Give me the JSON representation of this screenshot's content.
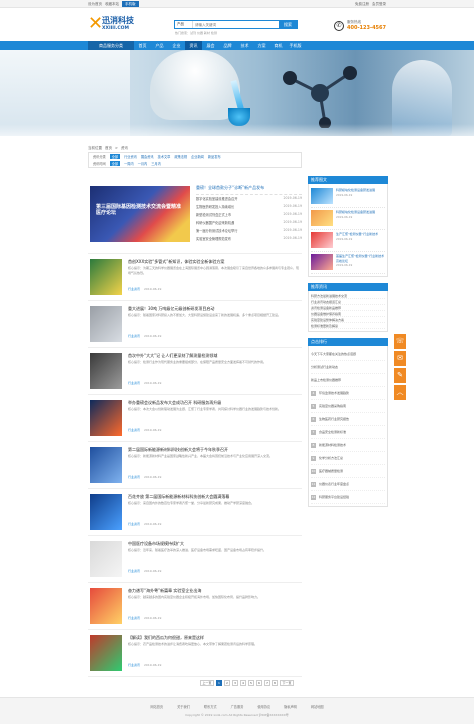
{
  "topbar": {
    "links": [
      "设为首页",
      "收藏本站"
    ],
    "app_button": "手机版",
    "right": [
      "免费注册",
      "会员登录"
    ]
  },
  "header": {
    "logo_cn": "迅消科技",
    "logo_en": "XXIIII.COM",
    "search_select": "产品",
    "search_placeholder": "请输入关键词",
    "search_button": "搜索",
    "hot_words": "热门搜索：试剂 仪器 耗材 检测",
    "phone_label": "服务热线",
    "phone_number": "400-123-4567"
  },
  "nav": {
    "category": "商品服务分类",
    "items": [
      "首页",
      "产品",
      "企业",
      "资讯",
      "展会",
      "品牌",
      "技术",
      "方案",
      "商机",
      "手机版"
    ],
    "active_index": 3
  },
  "breadcrumb": [
    "当前位置",
    "首页",
    "资讯"
  ],
  "filter": {
    "rows": [
      {
        "label": "资讯分类",
        "options": [
          "全部",
          "行业资讯",
          "展会资讯",
          "技术文章",
          "政策法规",
          "企业新闻",
          "新品发布"
        ]
      },
      {
        "label": "资讯时间",
        "options": [
          "全部",
          "一周内",
          "一月内",
          "三月内"
        ]
      }
    ]
  },
  "feature": {
    "image_text": "第三届国际基因检测技术交流会暨精准医疗论坛",
    "title": "重磅！全球首款分子“诊断”新产品发布",
    "list": [
      {
        "title": "数字化实验室建设推进会召开",
        "date": "2019-06-19"
      },
      {
        "title": "生物医药研发投入持续增长",
        "date": "2019-06-19"
      },
      {
        "title": "新型检测试剂盒正式上市",
        "date": "2019-06-19"
      },
      {
        "title": "科研仪器国产化迎来新机遇",
        "date": "2019-06-19"
      },
      {
        "title": "第一届分析测试技术论坛举行",
        "date": "2019-06-19"
      },
      {
        "title": "实验室安全管理规范发布",
        "date": "2019-06-19"
      }
    ]
  },
  "articles": [
    {
      "title": "首创XXX实验“多管式”新知识，体验实验全新体验方案",
      "summary": "核心提示：为期三天的科学仪器展览会在上海国际展览中心圆满落幕，本次展会吸引了来自世界各地的众多参展商与专业观众，现场气氛热烈。",
      "tag": "行业资讯",
      "date": "2019-06-19",
      "thumb": [
        "#2b7a3d",
        "#f3d34a"
      ]
    },
    {
      "title": "重大进展！30吨 万吨级亿元级创新研发项目启动",
      "summary": "核心提示：随着国家对科研投入的不断加大，大型科研设施建设迎来了新的发展机遇，多个重点项目相继开工建设。",
      "tag": "行业资讯",
      "date": "2019-06-19",
      "thumb": [
        "#9a9fa6",
        "#d8dde3"
      ]
    },
    {
      "title": "首次中外“大大”记  让人们更深刻了解测量检测领域",
      "summary": "核心提示：检测行业作为现代服务业的重要组成部分，在保障产品质量安全方面发挥着不可替代的作用。",
      "tag": "行业资讯",
      "date": "2019-06-19",
      "thumb": [
        "#3a3a3a",
        "#9c9c9c"
      ]
    },
    {
      "title": "举办重磅会议新品发布大会成功召开  科研服务再升级",
      "summary": "核心提示：本次大会以创新驱动发展为主题，汇聚了行业专家学者，共同探讨科学仪器行业的发展趋势与技术创新。",
      "tag": "行业资讯",
      "date": "2019-06-19",
      "thumb": [
        "#0d2a5c",
        "#ff6a2b"
      ]
    },
    {
      "title": "第二届国际新能源新材料科技创新大会将于今年秋季召开",
      "summary": "核心提示：新能源新材料产业是国家战略性新兴产业，本届大会将围绕前沿技术与产业化应用展开深入交流。",
      "tag": "行业资讯",
      "date": "2019-06-19",
      "thumb": [
        "#1f4f9e",
        "#7fb2ef"
      ]
    },
    {
      "title": "百花齐放  第二届国际新能源新材料科技创新大会圆满落幕",
      "summary": "核心提示：来自国内外的数百位专家学者齐聚一堂，分享最新研究成果，推动产学研深度融合。",
      "tag": "行业资讯",
      "date": "2019-06-19",
      "thumb": [
        "#0f3d8a",
        "#4aa0ff"
      ]
    },
    {
      "title": "中国医疗设备市场规模持续扩大",
      "summary": "核心提示：近年来，随着医疗改革的深入推进，医疗设备市场需求旺盛，国产设备市场占有率稳步提升。",
      "tag": "行业资讯",
      "date": "2019-06-19",
      "thumb": [
        "#d9d9d9",
        "#f5f5f5"
      ]
    },
    {
      "title": "奋力谱写“海外粤”新篇章 实验室企业出海",
      "summary": "核心提示：越来越多的国内实验室仪器企业积极开拓海外市场，加快国际化布局，提升品牌影响力。",
      "tag": "行业资讯",
      "date": "2019-06-19",
      "thumb": [
        "#e64b3c",
        "#ffd166"
      ]
    },
    {
      "title": "【解读】我们的西瓜为何很甜，原来是这样",
      "summary": "核心提示：农产品检测技术的进步让消费者吃得更放心，本文带你了解果蔬检测背后的科学原理。",
      "tag": "行业资讯",
      "date": "2019-06-19",
      "thumb": [
        "#c0392b",
        "#2ecc71"
      ]
    }
  ],
  "pager": [
    "上一页",
    "1",
    "2",
    "3",
    "4",
    "5",
    "6",
    "7",
    "8",
    "下一页"
  ],
  "sidebar": {
    "recommend_title": "推荐图文",
    "recommend": [
      {
        "title": "科研模块化检测设备研发进展",
        "date": "2019-06-19",
        "thumb": [
          "#1e88d6",
          "#bde3ff"
        ]
      },
      {
        "title": "科研模块化检测设备研发进展",
        "date": "2019-06-19",
        "thumb": [
          "#f2994a",
          "#ffe082"
        ]
      },
      {
        "title": "生产汇聚“检测仪器”行业新技术",
        "date": "2019-06-19",
        "thumb": [
          "#e53935",
          "#ffcdd2"
        ]
      },
      {
        "title": "首届生产汇聚“检测仪器”行业新技术高峰论坛",
        "date": "2019-06-19",
        "thumb": [
          "#6a1b9a",
          "#ffab91"
        ]
      }
    ],
    "hot_title": "推荐资讯",
    "hot_links": [
      "科研方法最新进展技术交流",
      "行业资讯动态报道汇总",
      "资讯检测设备新品推荐",
      "仪器设备维护保养指南",
      "实验室建设整体解决方案",
      "检测标准更新及解读"
    ],
    "rank_title": "点击排行",
    "rank": [
      "今天下午大家都在关注的热点话题",
      "分析测试行业新动态",
      "新品上市检测仪器推荐",
      "环境监测技术发展趋势",
      "实验室仪器采购指南",
      "生物医药行业研究报告",
      "食品安全检测新标准",
      "新能源材料检测技术",
      "化学分析方法汇总",
      "医疗器械质量检测",
      "仪器仪表行业年度盘点",
      "科研服务平台建设经验"
    ]
  },
  "float_buttons": [
    "phone-icon",
    "chat-icon",
    "edit-icon",
    "top-icon"
  ],
  "footer": {
    "links": [
      "网站首页",
      "关于我们",
      "联系方式",
      "广告服务",
      "使用协议",
      "隐私声明",
      "网站地图"
    ],
    "copyright": "Copyright © 2019 xxiiii.com All Rights Reserved  沪ICP备XXXXXXXX号"
  }
}
